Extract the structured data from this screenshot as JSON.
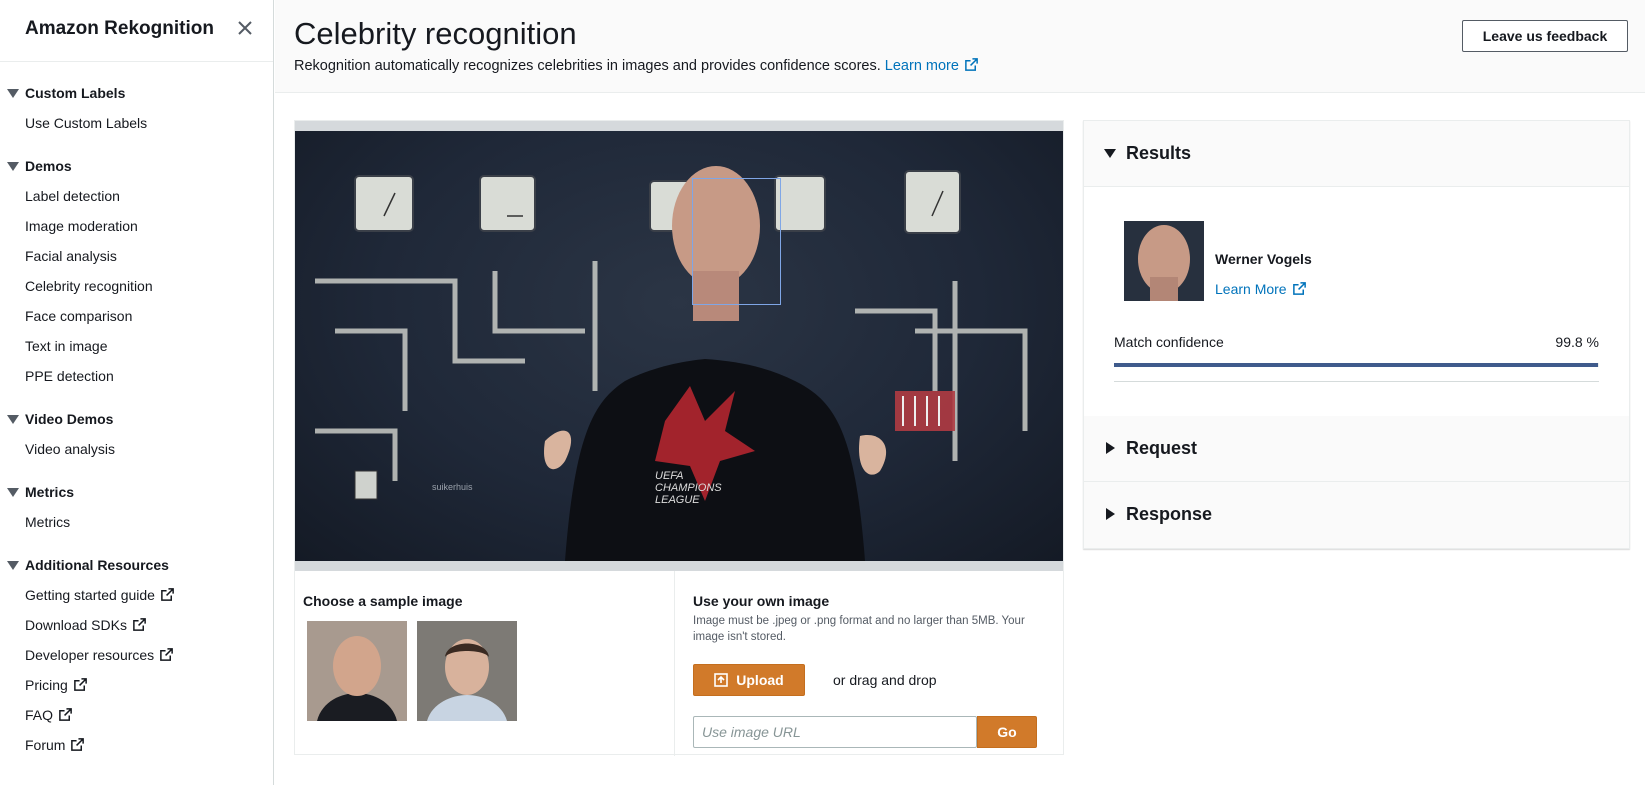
{
  "sidebar": {
    "title": "Amazon Rekognition",
    "sections": [
      {
        "label": "Custom Labels",
        "items": [
          {
            "label": "Use Custom Labels",
            "external": false
          }
        ]
      },
      {
        "label": "Demos",
        "items": [
          {
            "label": "Label detection",
            "external": false
          },
          {
            "label": "Image moderation",
            "external": false
          },
          {
            "label": "Facial analysis",
            "external": false
          },
          {
            "label": "Celebrity recognition",
            "external": false
          },
          {
            "label": "Face comparison",
            "external": false
          },
          {
            "label": "Text in image",
            "external": false
          },
          {
            "label": "PPE detection",
            "external": false
          }
        ]
      },
      {
        "label": "Video Demos",
        "items": [
          {
            "label": "Video analysis",
            "external": false
          }
        ]
      },
      {
        "label": "Metrics",
        "items": [
          {
            "label": "Metrics",
            "external": false
          }
        ]
      },
      {
        "label": "Additional Resources",
        "items": [
          {
            "label": "Getting started guide",
            "external": true
          },
          {
            "label": "Download SDKs",
            "external": true
          },
          {
            "label": "Developer resources",
            "external": true
          },
          {
            "label": "Pricing",
            "external": true
          },
          {
            "label": "FAQ",
            "external": true
          },
          {
            "label": "Forum",
            "external": true
          }
        ]
      }
    ]
  },
  "header": {
    "title": "Celebrity recognition",
    "description": "Rekognition automatically recognizes celebrities in images and provides confidence scores.",
    "learn_more": "Learn more",
    "feedback_label": "Leave us feedback"
  },
  "image_panel": {
    "shirt_text": [
      "UEFA",
      "CHAMPIONS",
      "LEAGUE"
    ],
    "wall_text": "suikerhuis"
  },
  "samples": {
    "title": "Choose a sample image"
  },
  "own_image": {
    "title": "Use your own image",
    "description": "Image must be .jpeg or .png format and no larger than 5MB. Your image isn't stored.",
    "upload_label": "Upload",
    "drag_text": "or drag and drop",
    "url_placeholder": "Use image URL",
    "url_value": "",
    "go_label": "Go"
  },
  "results": {
    "results_label": "Results",
    "request_label": "Request",
    "response_label": "Response",
    "celebrity_name": "Werner Vogels",
    "celebrity_link": "Learn More",
    "confidence_label": "Match confidence",
    "confidence_value": "99.8 %",
    "confidence_fraction": 0.998
  },
  "colors": {
    "accent_orange": "#d17a2a",
    "link_blue": "#0073bb",
    "confidence_bar": "#3f5b8c",
    "face_box": "#7fa6e6"
  }
}
